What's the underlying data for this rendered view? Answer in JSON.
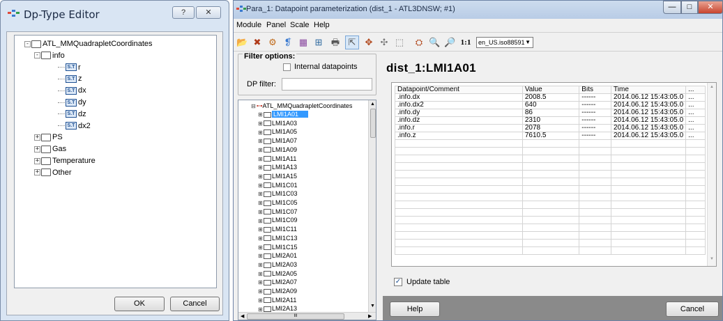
{
  "dialog": {
    "title": "Dp-Type Editor",
    "help_glyph": "?",
    "close_glyph": "✕",
    "tree": [
      {
        "label": "ATL_MMQuadrapletCoordinates",
        "level": 0,
        "kind": "folder",
        "expander": "-"
      },
      {
        "label": "info",
        "level": 1,
        "kind": "folder",
        "expander": "-"
      },
      {
        "label": "r",
        "level": 2,
        "kind": "struct"
      },
      {
        "label": "z",
        "level": 2,
        "kind": "struct"
      },
      {
        "label": "dx",
        "level": 2,
        "kind": "struct"
      },
      {
        "label": "dy",
        "level": 2,
        "kind": "struct"
      },
      {
        "label": "dz",
        "level": 2,
        "kind": "struct"
      },
      {
        "label": "dx2",
        "level": 2,
        "kind": "struct"
      },
      {
        "label": "PS",
        "level": 1,
        "kind": "folder",
        "expander": "+"
      },
      {
        "label": "Gas",
        "level": 1,
        "kind": "folder",
        "expander": "+"
      },
      {
        "label": "Temperature",
        "level": 1,
        "kind": "folder",
        "expander": "+"
      },
      {
        "label": "Other",
        "level": 1,
        "kind": "folder",
        "expander": "+"
      }
    ],
    "struct_glyph": "S.T",
    "ok_label": "OK",
    "cancel_label": "Cancel"
  },
  "window": {
    "title": "Para_1: Datapoint parameterization (dist_1 - ATL3DNSW; #1)",
    "minimize_glyph": "—",
    "maximize_glyph": "□",
    "close_glyph": "✕",
    "menu": [
      "Module",
      "Panel",
      "Scale",
      "Help"
    ],
    "toolbar_glyphs": [
      "📂",
      "✖",
      "⚙",
      "❡",
      "▦",
      "⊞",
      "🖶",
      "⇱",
      "✥",
      "✣",
      "⬚",
      "⛭",
      "🔍",
      "🔎"
    ],
    "zoom_label": "1:1",
    "locale_select": "en_US.iso88591",
    "filter": {
      "title": "Filter options:",
      "internal_label": "Internal datapoints",
      "dp_filter_label": "DP filter:",
      "dp_filter_value": ""
    },
    "tree": {
      "root": "ATL_MMQuadrapletCoordinates",
      "items": [
        "LMI1A01",
        "LMI1A03",
        "LMI1A05",
        "LMI1A07",
        "LMI1A09",
        "LMI1A11",
        "LMI1A13",
        "LMI1A15",
        "LMI1C01",
        "LMI1C03",
        "LMI1C05",
        "LMI1C07",
        "LMI1C09",
        "LMI1C11",
        "LMI1C13",
        "LMI1C15",
        "LMI2A01",
        "LMI2A03",
        "LMI2A05",
        "LMI2A07",
        "LMI2A09",
        "LMI2A11",
        "LMI2A13"
      ],
      "selected": "LMI1A01",
      "hscroll_glyph": "III"
    },
    "dp_title": "dist_1:LMI1A01",
    "table": {
      "headers": [
        "Datapoint/Comment",
        "Value",
        "Bits",
        "Time",
        "..."
      ],
      "rows": [
        [
          ".info.dx",
          "2008.5",
          "------",
          "2014.06.12 15:43:05.0"
        ],
        [
          ".info.dx2",
          "640",
          "------",
          "2014.06.12 15:43:05.0"
        ],
        [
          ".info.dy",
          "86",
          "------",
          "2014.06.12 15:43:05.0"
        ],
        [
          ".info.dz",
          "2310",
          "------",
          "2014.06.12 15:43:05.0"
        ],
        [
          ".info.r",
          "2078",
          "------",
          "2014.06.12 15:43:05.0"
        ],
        [
          ".info.z",
          "7610.5",
          "------",
          "2014.06.12 15:43:05.0"
        ]
      ],
      "ellipsis": "...",
      "empty_rows": 15
    },
    "update_table_label": "Update table",
    "update_table_checked": true,
    "help_button": "Help",
    "cancel_button": "Cancel"
  }
}
